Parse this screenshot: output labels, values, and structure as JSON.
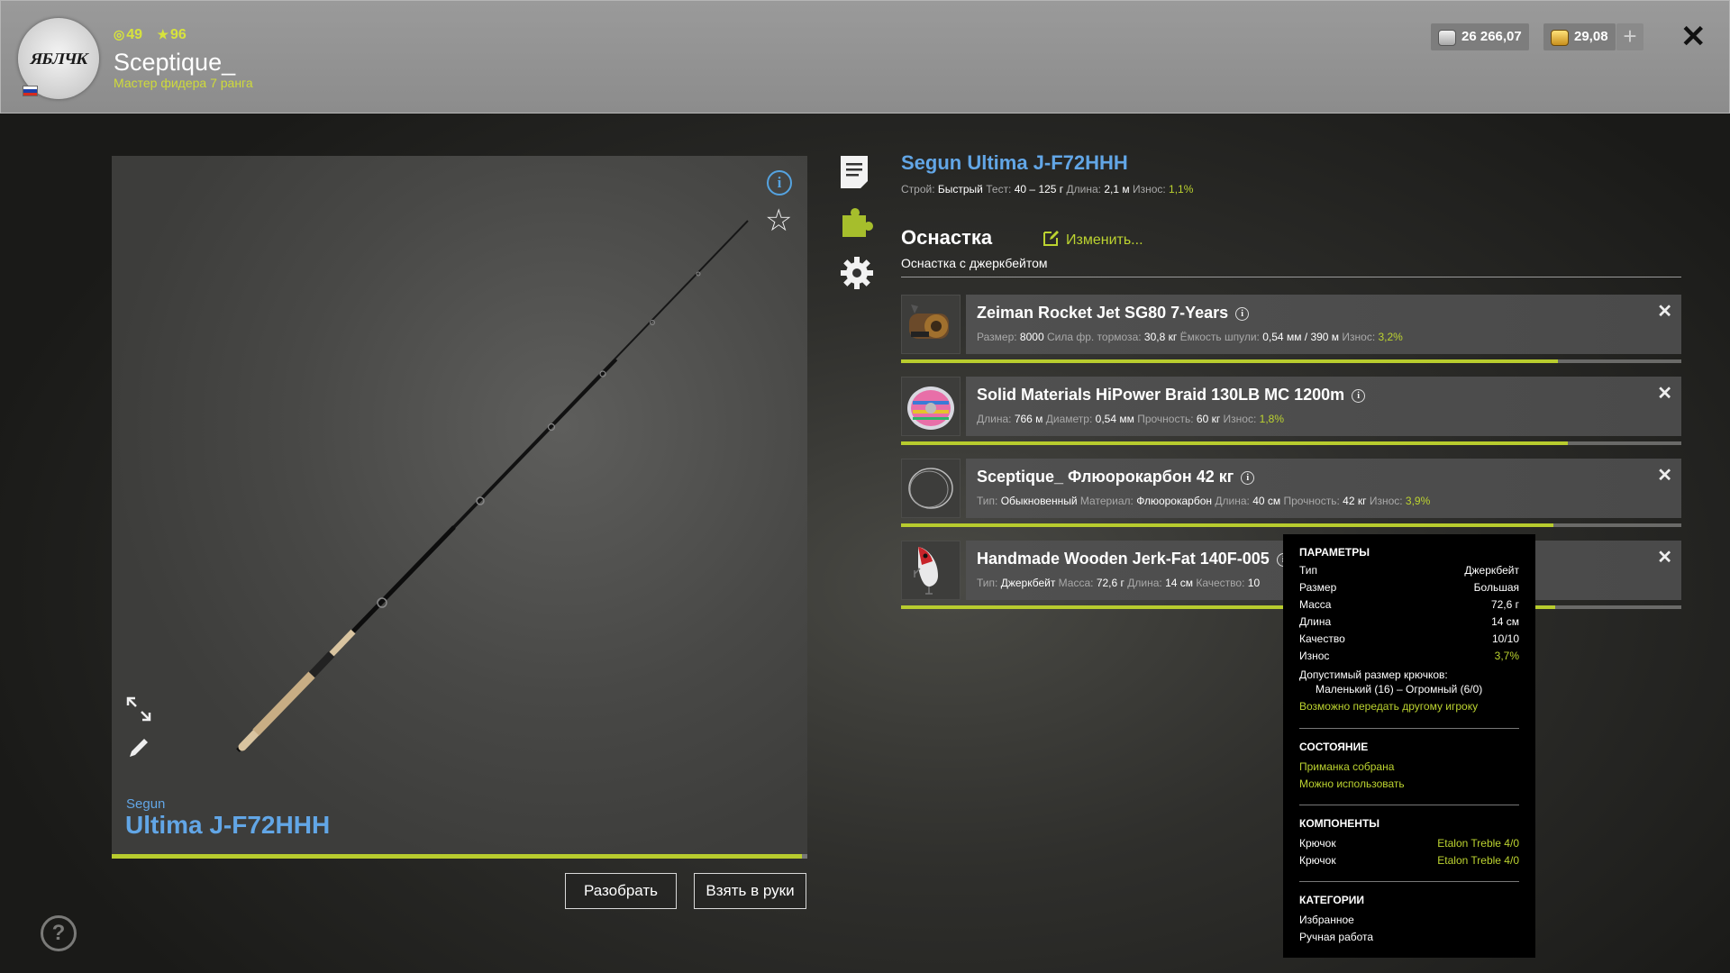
{
  "player": {
    "name": "Sceptique_",
    "rank": "Мастер фидера 7 ранга",
    "level": "49",
    "stars": "96",
    "avatar_logo": "ЯБЛЧК"
  },
  "wallet": {
    "silver": "26 266,07",
    "gold": "29,08",
    "add_label": "+"
  },
  "close_label": "✕",
  "preview": {
    "brand": "Segun",
    "model": "Ultima J-F72HHH",
    "condition_fraction": 0.99,
    "buttons": {
      "disassemble": "Разобрать",
      "take": "Взять в руки"
    }
  },
  "rod": {
    "title": "Segun Ultima J-F72HHH",
    "stats": [
      {
        "k": "Строй:",
        "v": "Быстрый"
      },
      {
        "k": "Тест:",
        "v": "40 – 125 г"
      },
      {
        "k": "Длина:",
        "v": "2,1 м"
      },
      {
        "k": "Износ:",
        "v": "1,1%",
        "green": true
      }
    ]
  },
  "rig": {
    "title": "Оснастка",
    "change_label": "Изменить...",
    "subtitle": "Оснастка с джеркбейтом"
  },
  "equipment": [
    {
      "name": "Zeiman Rocket Jet SG80 7-Years",
      "thumb": "reel",
      "condition_fraction": 0.968,
      "stats": [
        {
          "k": "Размер:",
          "v": "8000"
        },
        {
          "k": "Сила фр. тормоза:",
          "v": "30,8 кг"
        },
        {
          "k": "Ёмкость шпули:",
          "v": "0,54 мм / 390 м"
        },
        {
          "k": "Износ:",
          "v": "3,2%",
          "green": true
        }
      ]
    },
    {
      "name": "Solid Materials HiPower Braid 130LB MC 1200m",
      "thumb": "line-spool",
      "condition_fraction": 0.982,
      "stats": [
        {
          "k": "Длина:",
          "v": "766 м"
        },
        {
          "k": "Диаметр:",
          "v": "0,54 мм"
        },
        {
          "k": "Прочность:",
          "v": "60 кг"
        },
        {
          "k": "Износ:",
          "v": "1,8%",
          "green": true
        }
      ]
    },
    {
      "name": "Sceptique_ Флюорокарбон 42 кг",
      "thumb": "leader",
      "condition_fraction": 0.961,
      "stats": [
        {
          "k": "Тип:",
          "v": "Обыкновенный"
        },
        {
          "k": "Материал:",
          "v": "Флюорокарбон"
        },
        {
          "k": "Длина:",
          "v": "40 см"
        },
        {
          "k": "Прочность:",
          "v": "42 кг"
        },
        {
          "k": "Износ:",
          "v": "3,9%",
          "green": true
        }
      ]
    },
    {
      "name": "Handmade Wooden Jerk-Fat 140F-005",
      "thumb": "lure",
      "condition_fraction": 0.963,
      "stats": [
        {
          "k": "Тип:",
          "v": "Джеркбейт"
        },
        {
          "k": "Масса:",
          "v": "72,6 г"
        },
        {
          "k": "Длина:",
          "v": "14 см"
        },
        {
          "k": "Качество:",
          "v": "10"
        }
      ]
    }
  ],
  "tooltip": {
    "params_title": "ПАРАМЕТРЫ",
    "params": [
      {
        "k": "Тип",
        "v": "Джеркбейт"
      },
      {
        "k": "Размер",
        "v": "Большая"
      },
      {
        "k": "Масса",
        "v": "72,6 г"
      },
      {
        "k": "Длина",
        "v": "14 см"
      },
      {
        "k": "Качество",
        "v": "10/10"
      },
      {
        "k": "Износ",
        "v": "3,7%",
        "green": true
      }
    ],
    "hook_size_label": "Допустимый размер крючков:",
    "hook_size_value": "Маленький (16) – Огромный (6/0)",
    "transferable": "Возможно передать другому игроку",
    "state_title": "СОСТОЯНИЕ",
    "state": [
      "Приманка собрана",
      "Можно использовать"
    ],
    "components_title": "КОМПОНЕНТЫ",
    "components": [
      {
        "k": "Крючок",
        "v": "Etalon Treble 4/0"
      },
      {
        "k": "Крючок",
        "v": "Etalon Treble 4/0"
      }
    ],
    "categories_title": "КАТЕГОРИИ",
    "categories": [
      "Избранное",
      "Ручная работа"
    ]
  },
  "icons": {
    "side": [
      "document-icon",
      "puzzle-icon",
      "gear-icon"
    ],
    "preview": [
      "info-icon",
      "star-icon",
      "expand-icon",
      "pen-icon"
    ],
    "help": "help-icon"
  },
  "colors": {
    "accent_green": "#bcd330",
    "title_blue": "#62a6e6",
    "condition_bar": "#b8cc2e"
  }
}
